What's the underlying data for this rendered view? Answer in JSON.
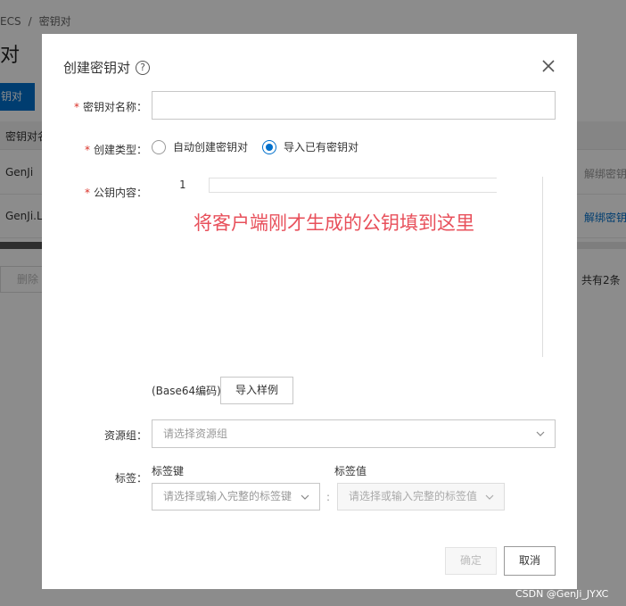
{
  "background": {
    "breadcrumb": [
      "ECS",
      "/",
      "密钥对"
    ],
    "page_title": "对",
    "create_button": "钥对",
    "table_header": "密钥对名",
    "rows": [
      {
        "name": "GenJi",
        "action": "解绑密钥"
      },
      {
        "name": "GenJi.Lo",
        "action": "解绑密钥"
      }
    ],
    "delete_button": "删除",
    "total": "共有2条"
  },
  "dialog": {
    "title": "创建密钥对",
    "help_icon": "?",
    "fields": {
      "name_label": "密钥对名称：",
      "name_value": "",
      "type_label": "创建类型：",
      "type_options": [
        "自动创建密钥对",
        "导入已有密钥对"
      ],
      "type_selected": 1,
      "pubkey_label": "公钥内容：",
      "editor_line": "1",
      "annotation": "将客户端刚才生成的公钥填到这里",
      "encoding_hint": "(Base64编码)",
      "import_sample_button": "导入样例",
      "resource_group_label": "资源组：",
      "resource_group_placeholder": "请选择资源组",
      "tags_label": "标签：",
      "tag_key_label": "标签键",
      "tag_key_placeholder": "请选择或输入完整的标签键",
      "tag_value_label": "标签值",
      "tag_value_placeholder": "请选择或输入完整的标签值",
      "colon": ":"
    },
    "footer": {
      "confirm_button": "确定",
      "cancel_button": "取消"
    }
  },
  "watermark": "CSDN @GenJi_JYXC",
  "colors": {
    "primary": "#0070cc",
    "required": "#d93026",
    "annotation": "#e8505b"
  }
}
